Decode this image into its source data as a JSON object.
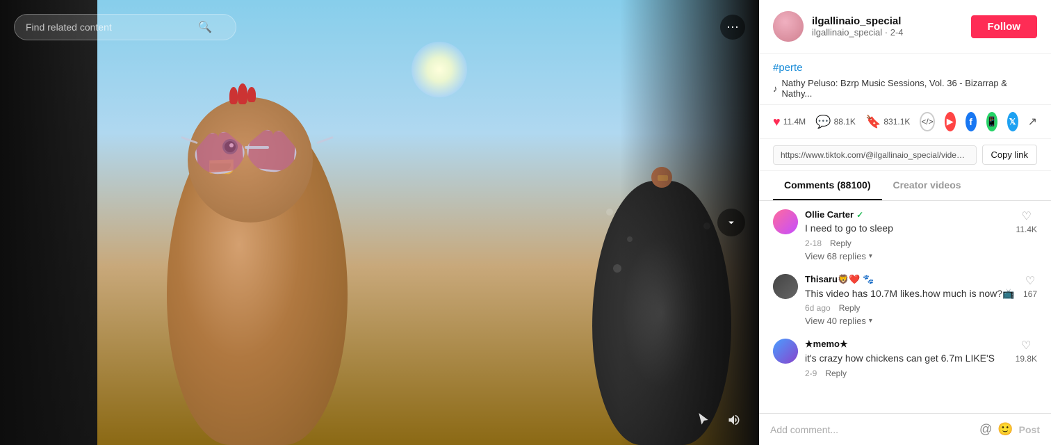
{
  "search": {
    "placeholder": "Find related content"
  },
  "user": {
    "username": "ilgallinaio_special",
    "handle": "ilgallinaio_special · 2-4",
    "follow_label": "Follow"
  },
  "video": {
    "hashtag": "#perte",
    "music": "Nathy Peluso: Bzrp Music Sessions, Vol. 36 - Bizarrap & Nathy...",
    "url": "https://www.tiktok.com/@ilgallinaio_special/video/733..."
  },
  "actions": {
    "likes": "11.4M",
    "comments": "88.1K",
    "bookmarks": "831.1K",
    "copy_link_label": "Copy link"
  },
  "tabs": {
    "comments_label": "Comments (88100)",
    "creator_videos_label": "Creator videos"
  },
  "comments": [
    {
      "username": "Ollie Carter",
      "verified": true,
      "avatar_class": "comment-avatar-1",
      "text": "I need to go to sleep",
      "timestamp": "2-18",
      "reply_label": "Reply",
      "likes": "11.4K",
      "view_replies": "View 68 replies"
    },
    {
      "username": "Thisaru🦁❤️ 🐾",
      "verified": false,
      "avatar_class": "comment-avatar-2",
      "text": "This video has 10.7M likes.how much is now?📺",
      "timestamp": "6d ago",
      "reply_label": "Reply",
      "likes": "167",
      "view_replies": "View 40 replies"
    },
    {
      "username": "★memo★",
      "verified": false,
      "avatar_class": "comment-avatar-3",
      "text": "it's crazy how chickens can get 6.7m LIKE'S",
      "timestamp": "2-9",
      "reply_label": "Reply",
      "likes": "19.8K",
      "view_replies": ""
    }
  ],
  "comment_input": {
    "placeholder": "Add comment..."
  },
  "buttons": {
    "post": "Post",
    "more": "⋯"
  }
}
